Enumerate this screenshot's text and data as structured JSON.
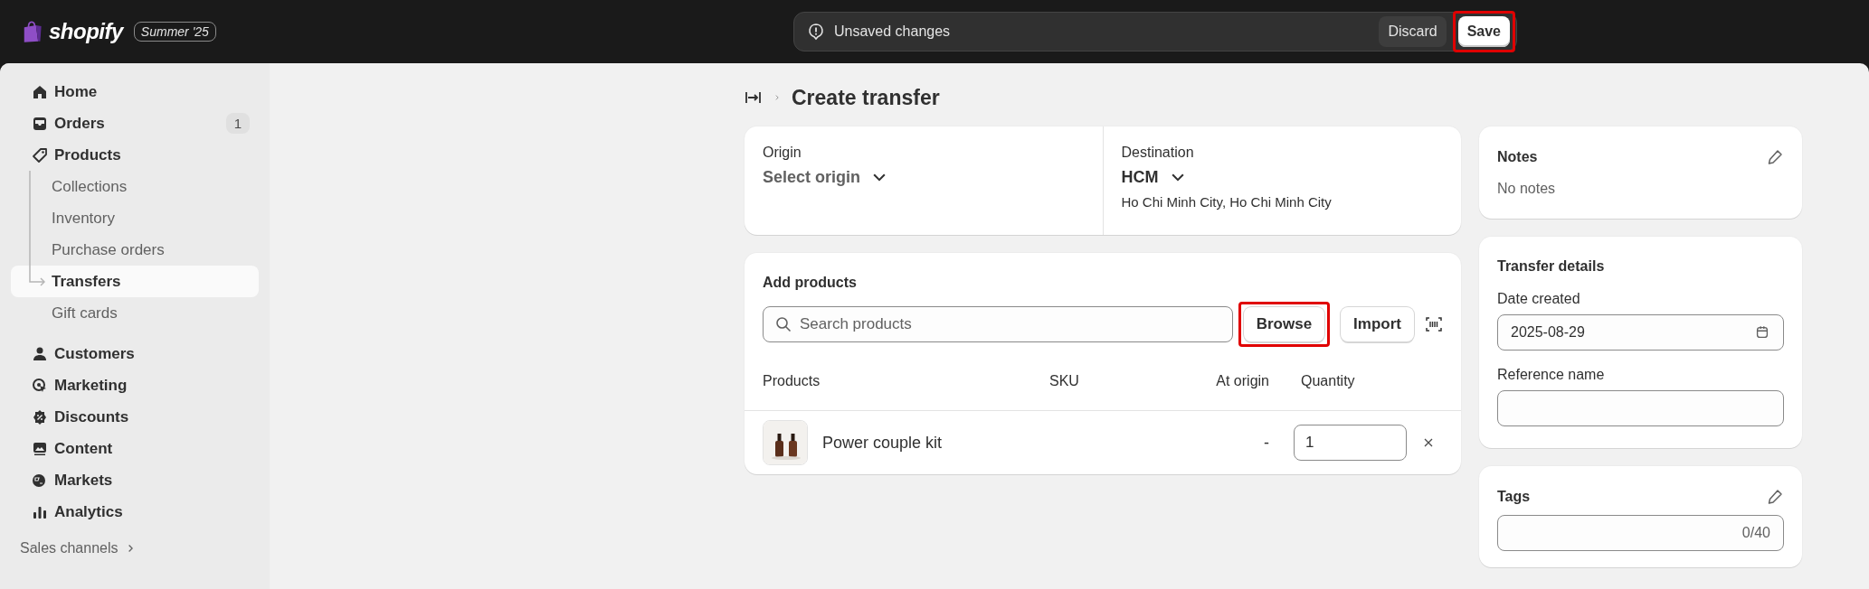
{
  "topbar": {
    "logo": "shopify",
    "edition": "Summer '25",
    "unsaved": {
      "message": "Unsaved changes",
      "buttons": [
        {
          "label": "Discard",
          "kind": "secondary",
          "highlighted": false
        },
        {
          "label": "Save",
          "kind": "primary",
          "highlighted": true
        }
      ]
    }
  },
  "sidebar": {
    "items": [
      {
        "label": "Home",
        "selected": false
      },
      {
        "label": "Orders",
        "badge": "1",
        "selected": false
      },
      {
        "label": "Products",
        "selected": false,
        "children": [
          {
            "label": "Collections",
            "selected": false
          },
          {
            "label": "Inventory",
            "selected": false
          },
          {
            "label": "Purchase orders",
            "selected": false
          },
          {
            "label": "Transfers",
            "selected": true
          },
          {
            "label": "Gift cards",
            "selected": false
          }
        ]
      },
      {
        "label": "Customers",
        "selected": false
      },
      {
        "label": "Marketing",
        "selected": false
      },
      {
        "label": "Discounts",
        "selected": false
      },
      {
        "label": "Content",
        "selected": false
      },
      {
        "label": "Markets",
        "selected": false
      },
      {
        "label": "Analytics",
        "selected": false
      }
    ],
    "section": "Sales channels"
  },
  "page": {
    "title": "Create transfer"
  },
  "locations": {
    "origin": {
      "label": "Origin",
      "value": "Select origin"
    },
    "destination": {
      "label": "Destination",
      "value": "HCM",
      "address": "Ho Chi Minh City, Ho Chi Minh City"
    }
  },
  "add_products": {
    "title": "Add products",
    "search": {
      "placeholder": "Search products"
    },
    "buttons": [
      {
        "label": "Browse",
        "highlighted": true
      },
      {
        "label": "Import",
        "highlighted": false
      }
    ],
    "columns": [
      "Products",
      "SKU",
      "At origin",
      "Quantity"
    ],
    "rows": [
      {
        "product": "Power couple kit",
        "at_origin": "-",
        "quantity": "1"
      }
    ]
  },
  "notes": {
    "title": "Notes",
    "text": "No notes"
  },
  "details": {
    "title": "Transfer details",
    "fields": [
      {
        "label": "Date created",
        "value": "2025-08-29",
        "kind": "date"
      },
      {
        "label": "Reference name",
        "kind": "text"
      }
    ]
  },
  "tags": {
    "title": "Tags",
    "counter": "0/40"
  }
}
